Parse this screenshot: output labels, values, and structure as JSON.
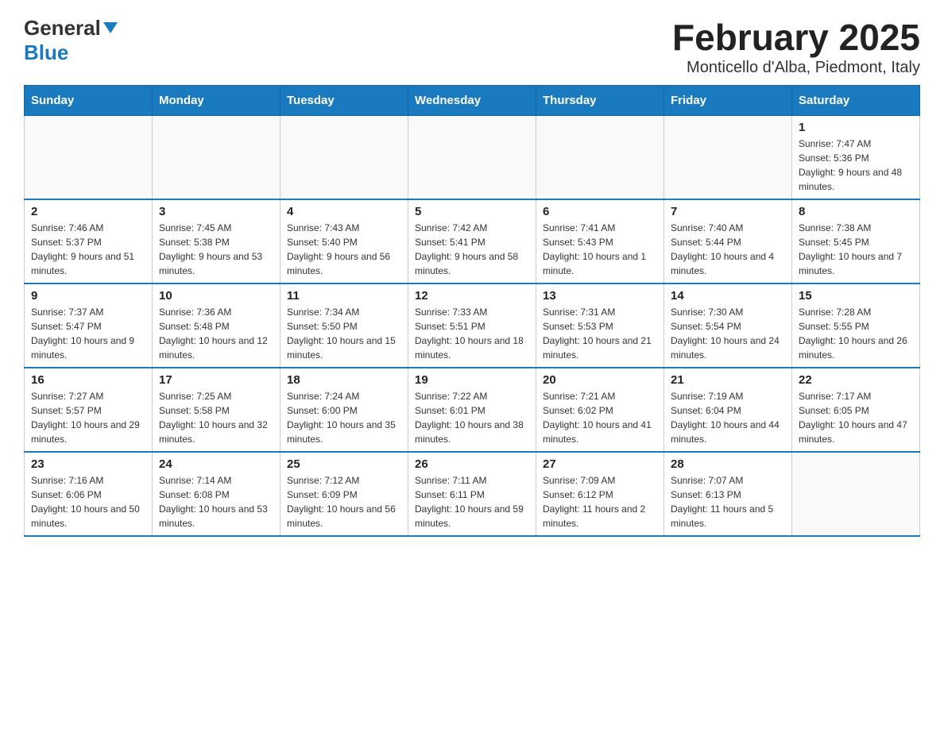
{
  "logo": {
    "text_general": "General",
    "text_blue": "Blue"
  },
  "title": "February 2025",
  "subtitle": "Monticello d'Alba, Piedmont, Italy",
  "days_of_week": [
    "Sunday",
    "Monday",
    "Tuesday",
    "Wednesday",
    "Thursday",
    "Friday",
    "Saturday"
  ],
  "weeks": [
    [
      {
        "day": "",
        "info": ""
      },
      {
        "day": "",
        "info": ""
      },
      {
        "day": "",
        "info": ""
      },
      {
        "day": "",
        "info": ""
      },
      {
        "day": "",
        "info": ""
      },
      {
        "day": "",
        "info": ""
      },
      {
        "day": "1",
        "info": "Sunrise: 7:47 AM\nSunset: 5:36 PM\nDaylight: 9 hours and 48 minutes."
      }
    ],
    [
      {
        "day": "2",
        "info": "Sunrise: 7:46 AM\nSunset: 5:37 PM\nDaylight: 9 hours and 51 minutes."
      },
      {
        "day": "3",
        "info": "Sunrise: 7:45 AM\nSunset: 5:38 PM\nDaylight: 9 hours and 53 minutes."
      },
      {
        "day": "4",
        "info": "Sunrise: 7:43 AM\nSunset: 5:40 PM\nDaylight: 9 hours and 56 minutes."
      },
      {
        "day": "5",
        "info": "Sunrise: 7:42 AM\nSunset: 5:41 PM\nDaylight: 9 hours and 58 minutes."
      },
      {
        "day": "6",
        "info": "Sunrise: 7:41 AM\nSunset: 5:43 PM\nDaylight: 10 hours and 1 minute."
      },
      {
        "day": "7",
        "info": "Sunrise: 7:40 AM\nSunset: 5:44 PM\nDaylight: 10 hours and 4 minutes."
      },
      {
        "day": "8",
        "info": "Sunrise: 7:38 AM\nSunset: 5:45 PM\nDaylight: 10 hours and 7 minutes."
      }
    ],
    [
      {
        "day": "9",
        "info": "Sunrise: 7:37 AM\nSunset: 5:47 PM\nDaylight: 10 hours and 9 minutes."
      },
      {
        "day": "10",
        "info": "Sunrise: 7:36 AM\nSunset: 5:48 PM\nDaylight: 10 hours and 12 minutes."
      },
      {
        "day": "11",
        "info": "Sunrise: 7:34 AM\nSunset: 5:50 PM\nDaylight: 10 hours and 15 minutes."
      },
      {
        "day": "12",
        "info": "Sunrise: 7:33 AM\nSunset: 5:51 PM\nDaylight: 10 hours and 18 minutes."
      },
      {
        "day": "13",
        "info": "Sunrise: 7:31 AM\nSunset: 5:53 PM\nDaylight: 10 hours and 21 minutes."
      },
      {
        "day": "14",
        "info": "Sunrise: 7:30 AM\nSunset: 5:54 PM\nDaylight: 10 hours and 24 minutes."
      },
      {
        "day": "15",
        "info": "Sunrise: 7:28 AM\nSunset: 5:55 PM\nDaylight: 10 hours and 26 minutes."
      }
    ],
    [
      {
        "day": "16",
        "info": "Sunrise: 7:27 AM\nSunset: 5:57 PM\nDaylight: 10 hours and 29 minutes."
      },
      {
        "day": "17",
        "info": "Sunrise: 7:25 AM\nSunset: 5:58 PM\nDaylight: 10 hours and 32 minutes."
      },
      {
        "day": "18",
        "info": "Sunrise: 7:24 AM\nSunset: 6:00 PM\nDaylight: 10 hours and 35 minutes."
      },
      {
        "day": "19",
        "info": "Sunrise: 7:22 AM\nSunset: 6:01 PM\nDaylight: 10 hours and 38 minutes."
      },
      {
        "day": "20",
        "info": "Sunrise: 7:21 AM\nSunset: 6:02 PM\nDaylight: 10 hours and 41 minutes."
      },
      {
        "day": "21",
        "info": "Sunrise: 7:19 AM\nSunset: 6:04 PM\nDaylight: 10 hours and 44 minutes."
      },
      {
        "day": "22",
        "info": "Sunrise: 7:17 AM\nSunset: 6:05 PM\nDaylight: 10 hours and 47 minutes."
      }
    ],
    [
      {
        "day": "23",
        "info": "Sunrise: 7:16 AM\nSunset: 6:06 PM\nDaylight: 10 hours and 50 minutes."
      },
      {
        "day": "24",
        "info": "Sunrise: 7:14 AM\nSunset: 6:08 PM\nDaylight: 10 hours and 53 minutes."
      },
      {
        "day": "25",
        "info": "Sunrise: 7:12 AM\nSunset: 6:09 PM\nDaylight: 10 hours and 56 minutes."
      },
      {
        "day": "26",
        "info": "Sunrise: 7:11 AM\nSunset: 6:11 PM\nDaylight: 10 hours and 59 minutes."
      },
      {
        "day": "27",
        "info": "Sunrise: 7:09 AM\nSunset: 6:12 PM\nDaylight: 11 hours and 2 minutes."
      },
      {
        "day": "28",
        "info": "Sunrise: 7:07 AM\nSunset: 6:13 PM\nDaylight: 11 hours and 5 minutes."
      },
      {
        "day": "",
        "info": ""
      }
    ]
  ]
}
